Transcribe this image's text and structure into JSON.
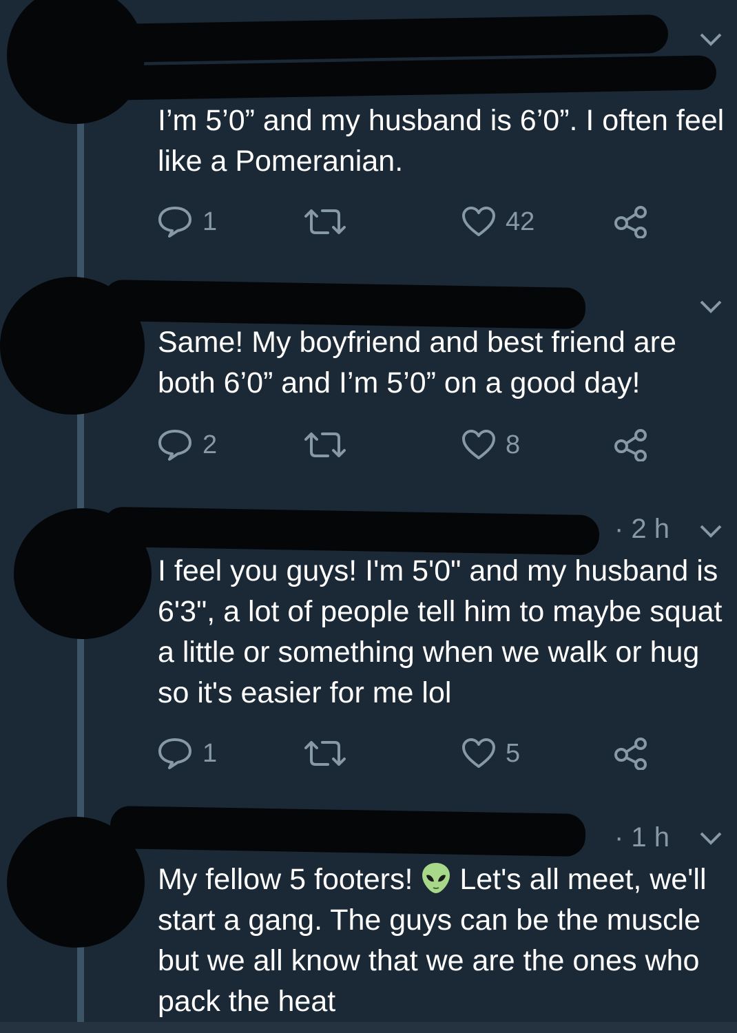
{
  "colors": {
    "background": "#1b2836",
    "thread_line": "#3d5466",
    "text": "#ffffff",
    "muted": "#8899a6",
    "redaction": "#050608"
  },
  "icons": {
    "reply": "reply-bubble-icon",
    "retweet": "retweet-arrows-icon",
    "like": "heart-icon",
    "share": "share-nodes-icon",
    "menu": "chevron-down-icon",
    "emoji": "alien-emoji-icon"
  },
  "tweets": [
    {
      "time": "",
      "text": "I’m 5’0” and my husband is 6’0”. I often feel like a Pomeranian.",
      "replies": "1",
      "retweets": "",
      "likes": "42"
    },
    {
      "time": "",
      "text": "Same! My boyfriend and best friend are both 6’0” and I’m 5’0” on a good day!",
      "replies": "2",
      "retweets": "",
      "likes": "8"
    },
    {
      "time": "· 2 h",
      "text": "I feel you guys! I'm 5'0\" and my husband is 6'3\", a lot of people tell him to maybe squat a little or something when we walk or hug so it's easier for me lol",
      "replies": "1",
      "retweets": "",
      "likes": "5"
    },
    {
      "time": "· 1 h",
      "text_before_emoji": "My fellow 5 footers! ",
      "text_after_emoji": " Let's all meet, we'll start a gang. The guys can be the muscle but we all know that we are the ones who pack the heat"
    }
  ]
}
